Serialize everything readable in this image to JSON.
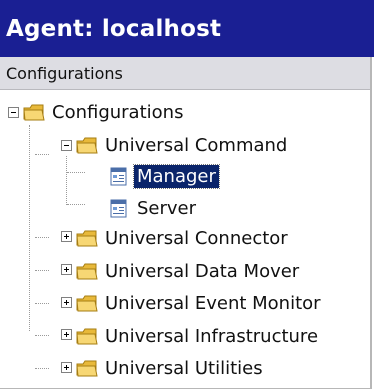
{
  "window": {
    "title": "Agent: localhost"
  },
  "panel": {
    "header": "Configurations"
  },
  "tree": {
    "root": {
      "label": "Configurations",
      "expanded": true,
      "icon": "folder-icon"
    },
    "universal_command": {
      "label": "Universal Command",
      "expanded": true,
      "icon": "folder-icon"
    },
    "manager": {
      "label": "Manager",
      "selected": true,
      "icon": "config-document-icon"
    },
    "server": {
      "label": "Server",
      "icon": "config-document-icon"
    },
    "universal_connector": {
      "label": "Universal Connector",
      "expanded": false,
      "icon": "folder-icon"
    },
    "universal_data_mover": {
      "label": "Universal Data Mover",
      "expanded": false,
      "icon": "folder-icon"
    },
    "universal_event_monitor": {
      "label": "Universal Event Monitor",
      "expanded": false,
      "icon": "folder-icon"
    },
    "universal_infrastructure": {
      "label": "Universal Infrastructure",
      "expanded": false,
      "icon": "folder-icon"
    },
    "universal_utilities": {
      "label": "Universal Utilities",
      "expanded": false,
      "icon": "folder-icon"
    }
  },
  "colors": {
    "titlebar": "#1a1f93",
    "panel_header": "#dddde3",
    "selection": "#0a246a",
    "folder": "#f3c94c"
  }
}
